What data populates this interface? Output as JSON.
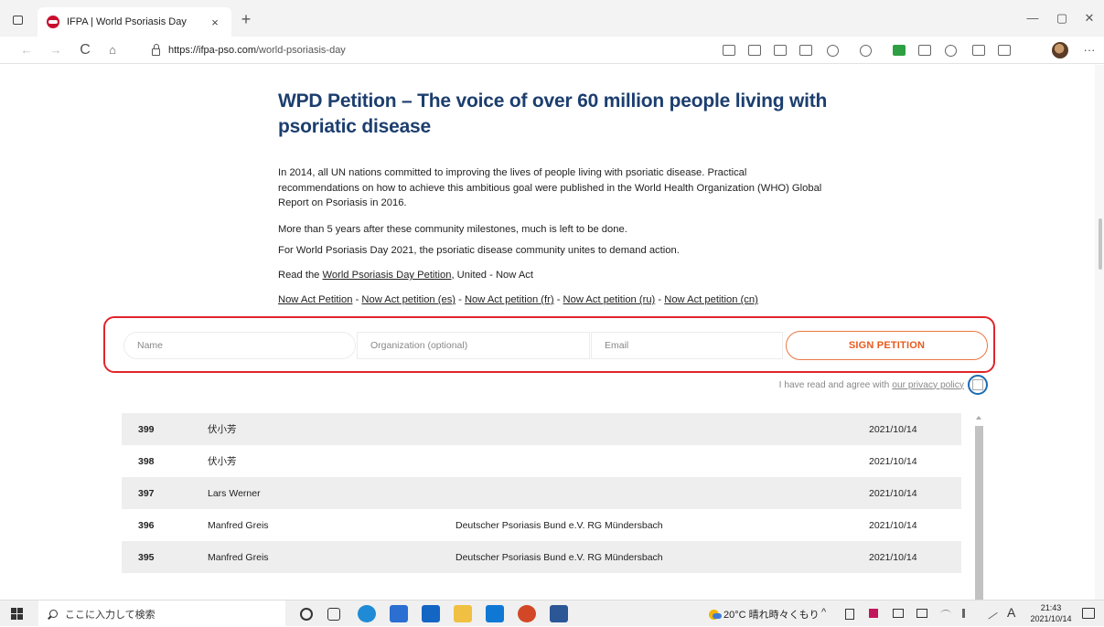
{
  "browser": {
    "tab_title": "IFPA | World Psoriasis Day",
    "tab_close": "×",
    "new_tab": "+",
    "url_host": "https://ifpa-pso.com",
    "url_path": "/world-psoriasis-day",
    "back": "←",
    "forward": "→",
    "refresh": "C",
    "home": "⌂",
    "more": "···",
    "minimize": "—",
    "maximize": "▢",
    "close": "✕"
  },
  "page": {
    "title": "WPD Petition – The voice of over 60 million people living with psoriatic disease",
    "p1": "In 2014, all UN nations committed to improving the lives of people living with psoriatic disease. Practical recommendations on how to achieve this ambitious goal were published in the World Health Organization (WHO) Global Report on Psoriasis in 2016.",
    "p2": "More than 5 years after these community milestones, much is left to be done.",
    "p3": "For World Psoriasis Day 2021, the psoriatic disease community unites to demand action.",
    "p4_prefix": "Read the ",
    "p4_link": "World Psoriasis Day Petition",
    "p4_suffix": ", United - Now Act",
    "petition_links": [
      "Now Act Petition",
      "Now Act petition (es)",
      "Now Act petition (fr)",
      "Now Act petition (ru)",
      "Now Act petition (cn)"
    ],
    "link_separator": " - "
  },
  "form": {
    "name_placeholder": "Name",
    "org_placeholder": "Organization (optional)",
    "email_placeholder": "Email",
    "sign_label": "SIGN PETITION",
    "privacy_text": "I have read and agree with",
    "privacy_link": "our privacy policy"
  },
  "signers": [
    {
      "num": "399",
      "name": "伏小芳",
      "org": "",
      "date": "2021/10/14"
    },
    {
      "num": "398",
      "name": "伏小芳",
      "org": "",
      "date": "2021/10/14"
    },
    {
      "num": "397",
      "name": "Lars Werner",
      "org": "",
      "date": "2021/10/14"
    },
    {
      "num": "396",
      "name": "Manfred Greis",
      "org": "Deutscher Psoriasis Bund e.V. RG Mündersbach",
      "date": "2021/10/14"
    },
    {
      "num": "395",
      "name": "Manfred Greis",
      "org": "Deutscher Psoriasis Bund e.V. RG Mündersbach",
      "date": "2021/10/14"
    }
  ],
  "taskbar": {
    "search_placeholder": "ここに入力して検索",
    "weather": "20°C 晴れ時々くもり",
    "ime": "A",
    "time": "21:43",
    "date": "2021/10/14",
    "tray_up": "^"
  },
  "colors": {
    "title_blue": "#1c3e6e",
    "highlight_red": "#e0252b",
    "sign_orange": "#e85a1e",
    "checkbox_highlight": "#1b6bb5"
  }
}
